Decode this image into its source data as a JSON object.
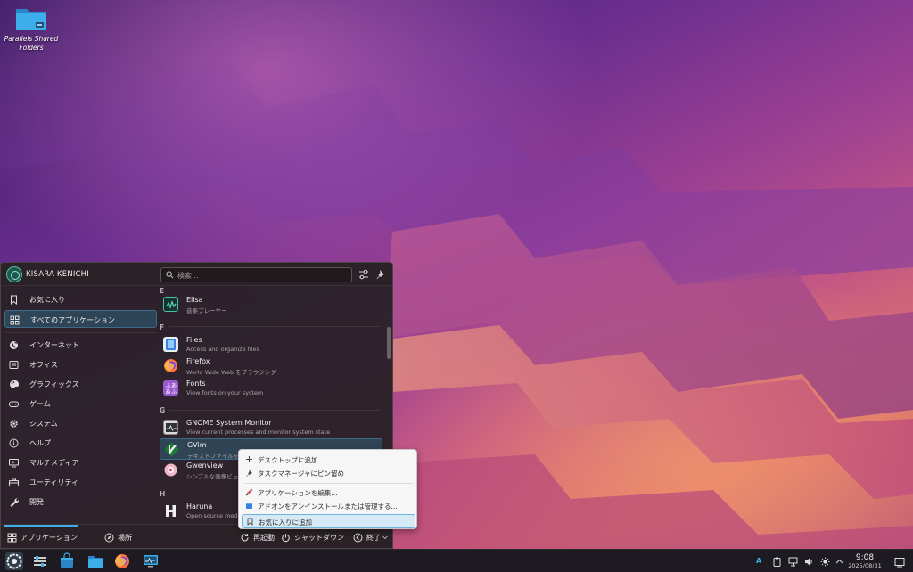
{
  "desktop": {
    "icon_label": "Parallels Shared Folders"
  },
  "launcher": {
    "username": "KISARA KENICHI",
    "search_placeholder": "検索...",
    "sidebar": [
      {
        "label": "お気に入り",
        "icon": "bookmark-icon"
      },
      {
        "label": "すべてのアプリケーション",
        "icon": "grid-icon",
        "active": true
      },
      {
        "label": "インターネット",
        "icon": "globe-icon"
      },
      {
        "label": "オフィス",
        "icon": "office-icon"
      },
      {
        "label": "グラフィックス",
        "icon": "palette-icon"
      },
      {
        "label": "ゲーム",
        "icon": "gamepad-icon"
      },
      {
        "label": "システム",
        "icon": "gear-icon"
      },
      {
        "label": "ヘルプ",
        "icon": "info-icon"
      },
      {
        "label": "マルチメディア",
        "icon": "monitor-icon"
      },
      {
        "label": "ユーティリティ",
        "icon": "toolbox-icon"
      },
      {
        "label": "開発",
        "icon": "wrench-icon"
      }
    ],
    "sections": {
      "e": "E",
      "f": "F",
      "g": "G",
      "h": "H"
    },
    "apps": [
      {
        "name": "Elisa",
        "desc": "音楽プレーヤー"
      },
      {
        "name": "Files",
        "desc": "Access and organize files"
      },
      {
        "name": "Firefox",
        "desc": "World Wide Web をブラウジング"
      },
      {
        "name": "Fonts",
        "desc": "View fonts on your system"
      },
      {
        "name": "GNOME System Monitor",
        "desc": "View current processes and monitor system state"
      },
      {
        "name": "GVim",
        "desc": "テキストファイルを"
      },
      {
        "name": "Gwenview",
        "desc": "シンプルな画像ビュ"
      },
      {
        "name": "Haruna",
        "desc": "Open source medi"
      }
    ],
    "footer": {
      "applications": "アプリケーション",
      "places": "場所",
      "restart": "再起動",
      "shutdown": "シャットダウン",
      "leave": "終了"
    }
  },
  "context_menu": [
    {
      "label": "デスクトップに追加",
      "icon": "plus-icon"
    },
    {
      "label": "タスクマネージャにピン留め",
      "icon": "pin-icon"
    },
    {
      "label": "アプリケーションを編集...",
      "icon": "edit-icon"
    },
    {
      "label": "アドオンをアンインストールまたは管理する...",
      "icon": "package-icon"
    },
    {
      "label": "お気に入りに追加",
      "icon": "bookmark-icon",
      "highlighted": true
    }
  ],
  "taskbar": {
    "time": "9:08",
    "date": "2025/08/31",
    "keyboard_layout": "A"
  },
  "colors": {
    "accent": "#3daee9",
    "panel_bg": "#2a2226",
    "menu_bg": "#f7f6f7"
  }
}
